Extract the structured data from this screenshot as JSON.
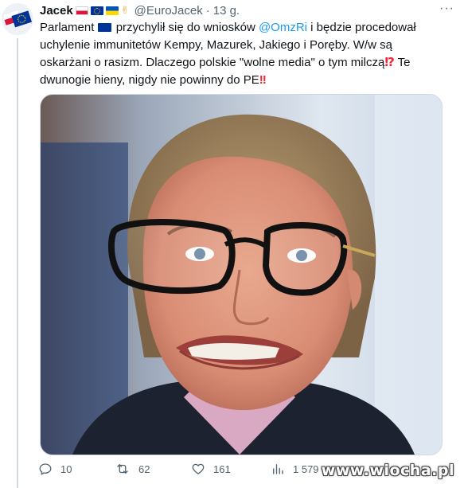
{
  "tweet": {
    "display_name": "Jacek",
    "hand_emoji": "✌",
    "handle": "@EuroJacek",
    "separator": "·",
    "time": "13 g.",
    "more_label": "···",
    "text": {
      "p1": "Parlament ",
      "p2": " przychylił się do wniosków ",
      "mention": "@OmzRi",
      "p3": " i będzie procedował uchylenie immunitetów Kempy, Mazurek, Jakiego i Poręby. W/w są oskarżani o rasizm. Dlaczego polskie \"wolne media\" o tym milczą",
      "emoji1": "⁉",
      "p4": " Te dwunogie hieny, nigdy nie powinny do PE",
      "emoji2": "‼"
    },
    "stats": {
      "replies": "10",
      "retweets": "62",
      "likes": "161",
      "views": "1 579"
    }
  },
  "icons": {
    "avatar": "eu-poland-flags-avatar",
    "reply": "reply-icon",
    "retweet": "retweet-icon",
    "like": "heart-icon",
    "views": "views-chart-icon"
  },
  "watermark": "www.wiocha.pl",
  "colors": {
    "link": "#1d9bf0",
    "secondary_text": "#536471",
    "border": "#cfd9de"
  }
}
